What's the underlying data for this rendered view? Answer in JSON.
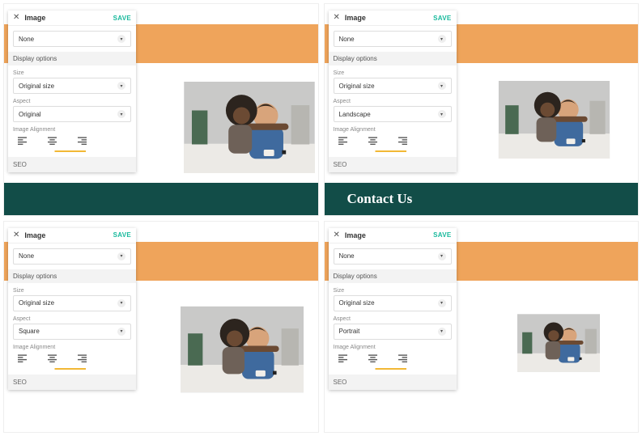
{
  "panel_common": {
    "title": "Image",
    "save_label": "SAVE",
    "none_option": "None",
    "display_options_label": "Display options",
    "size_label": "Size",
    "size_value": "Original size",
    "aspect_label": "Aspect",
    "alignment_label": "Image Alignment",
    "seo_label": "SEO"
  },
  "contact_text": "Contact Us",
  "variants": [
    {
      "id": "original",
      "aspect_value": "Original",
      "teal": true,
      "teal_visible": false,
      "underline_pos": "center"
    },
    {
      "id": "landscape",
      "aspect_value": "Landscape",
      "teal": true,
      "teal_visible": true,
      "underline_pos": "center"
    },
    {
      "id": "square",
      "aspect_value": "Square",
      "teal": false,
      "teal_visible": false,
      "underline_pos": "center"
    },
    {
      "id": "portrait",
      "aspect_value": "Portrait",
      "teal": false,
      "teal_visible": false,
      "underline_pos": "center"
    }
  ]
}
